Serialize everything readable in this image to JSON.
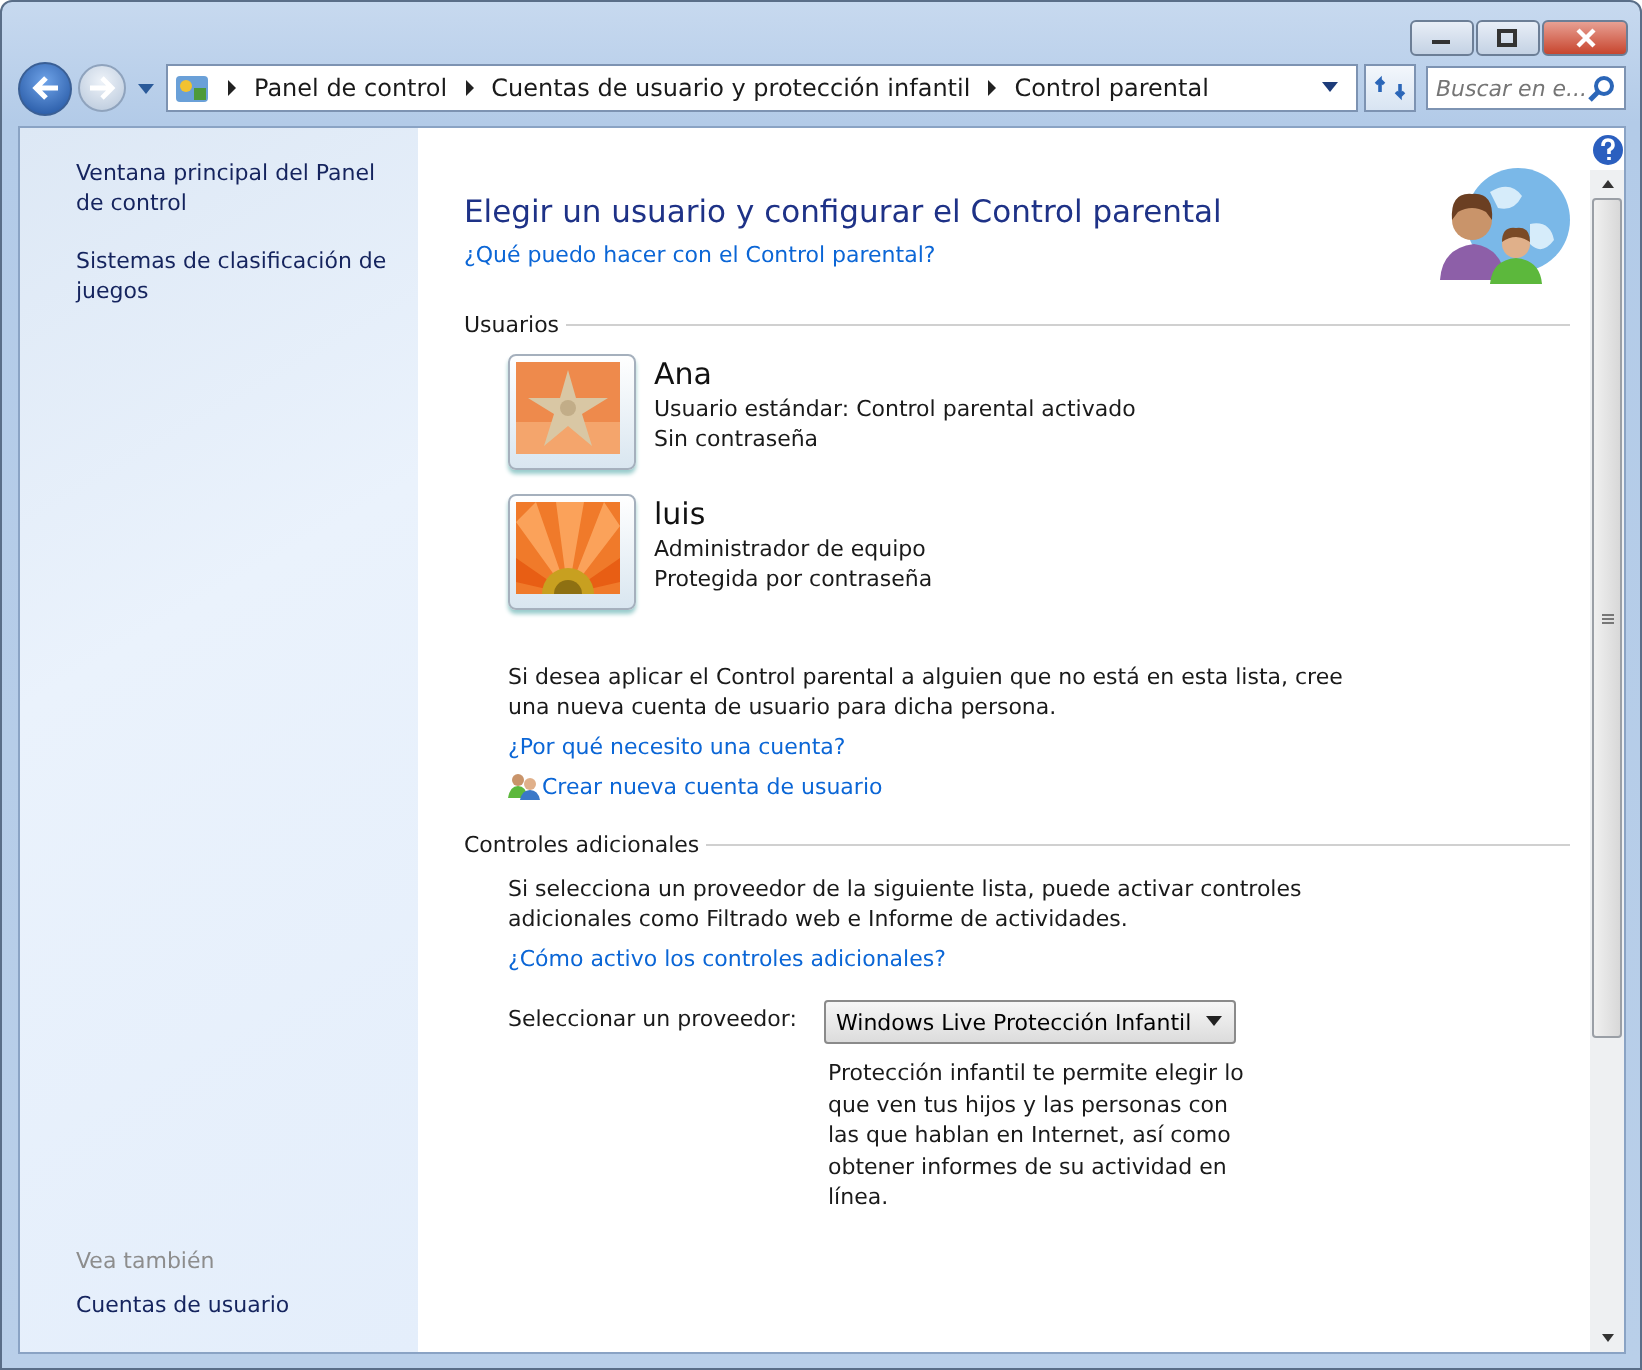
{
  "breadcrumb": [
    "Panel de control",
    "Cuentas de usuario y protección infantil",
    "Control parental"
  ],
  "search": {
    "placeholder": "Buscar en e..."
  },
  "sidebar": {
    "items": [
      "Ventana principal del Panel de control",
      "Sistemas de clasificación de juegos"
    ],
    "see_also_title": "Vea también",
    "see_also": [
      "Cuentas de usuario"
    ]
  },
  "title": "Elegir un usuario y configurar el Control parental",
  "help_link": "¿Qué puedo hacer con el Control parental?",
  "users_section": "Usuarios",
  "users": [
    {
      "name": "Ana",
      "type": "Usuario estándar: Control parental activado",
      "password": "Sin contraseña"
    },
    {
      "name": "luis",
      "type": "Administrador de equipo",
      "password": "Protegida por contraseña"
    }
  ],
  "users_note": "Si desea aplicar el Control parental a alguien que no está en esta lista, cree una nueva cuenta de usuario para dicha persona.",
  "why_link": "¿Por qué necesito una cuenta?",
  "create_link": "Crear nueva cuenta de usuario",
  "extra_section": "Controles adicionales",
  "extra_note": "Si selecciona un proveedor de la siguiente lista, puede activar controles adicionales como Filtrado web e Informe de actividades.",
  "extra_link": "¿Cómo activo los controles adicionales?",
  "provider_label": "Seleccionar un proveedor:",
  "provider_value": "Windows Live Protección Infantil",
  "provider_desc": "Protección infantil te permite elegir lo que ven tus hijos y las personas con las que hablan en Internet, así como obtener informes de su actividad en línea."
}
